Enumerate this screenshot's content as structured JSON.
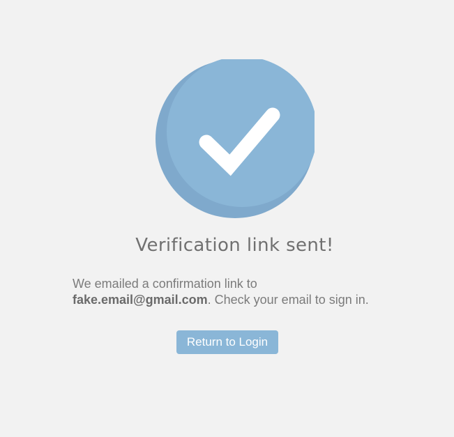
{
  "icon": {
    "name": "checkmark-circle-icon",
    "color": "#8ab6d7",
    "shade_color": "#7fa9cc"
  },
  "title": "Verification link sent!",
  "message": {
    "prefix": "We emailed a confirmation link to",
    "email": "fake.email@gmail.com",
    "suffix": ". Check your email to sign in."
  },
  "button": {
    "label": "Return to Login",
    "color": "#8ab6d7"
  }
}
